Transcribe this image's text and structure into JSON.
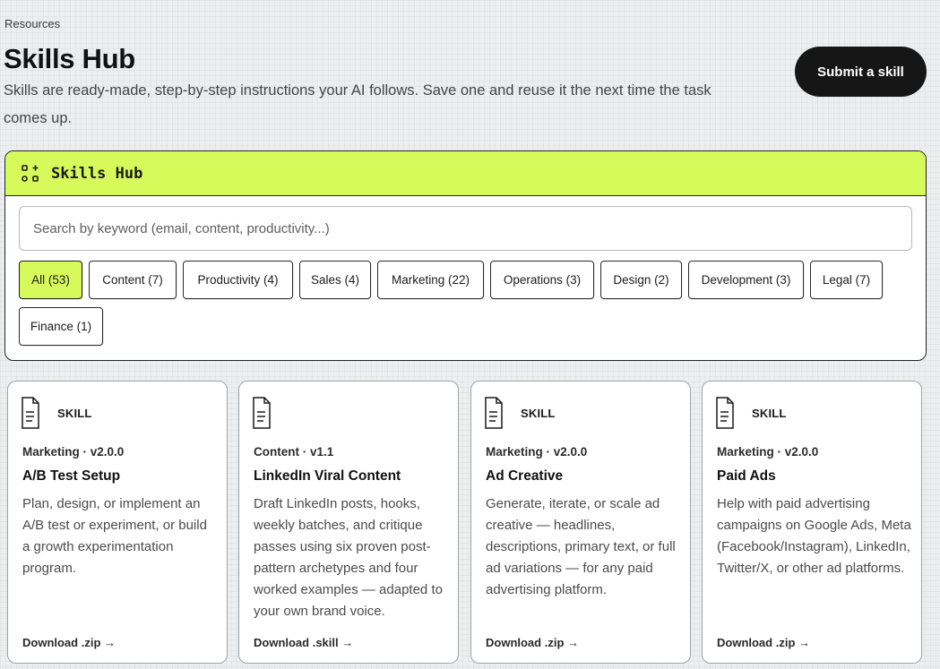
{
  "breadcrumb": "Resources",
  "header": {
    "title": "Skills Hub",
    "description": "Skills are ready-made, step-by-step instructions your AI follows. Save one and reuse it the next time the task comes up.",
    "submit_label": "Submit a skill"
  },
  "hub": {
    "icon": "grid-plus-icon",
    "title": "Skills Hub",
    "search_placeholder": "Search by keyword (email, content, productivity...)",
    "search_value": "",
    "filters": [
      {
        "label": "All (53)",
        "active": true
      },
      {
        "label": "Content (7)",
        "active": false
      },
      {
        "label": "Productivity (4)",
        "active": false
      },
      {
        "label": "Sales (4)",
        "active": false
      },
      {
        "label": "Marketing (22)",
        "active": false
      },
      {
        "label": "Operations (3)",
        "active": false
      },
      {
        "label": "Design (2)",
        "active": false
      },
      {
        "label": "Development (3)",
        "active": false
      },
      {
        "label": "Legal (7)",
        "active": false
      },
      {
        "label": "Finance (1)",
        "active": false
      }
    ]
  },
  "cards": [
    {
      "icon": "document-icon",
      "tag": "SKILL",
      "meta": "Marketing · v2.0.0",
      "title": "A/B Test Setup",
      "description": "Plan, design, or implement an A/B test or experiment, or build a growth experimentation program.",
      "download": "Download .zip →"
    },
    {
      "icon": "document-icon",
      "tag": "",
      "meta": "Content · v1.1",
      "title": "LinkedIn Viral Content",
      "description": "Draft LinkedIn posts, hooks, weekly batches, and critique passes using six proven post-pattern archetypes and four worked examples — adapted to your own brand voice.",
      "download": "Download .skill →"
    },
    {
      "icon": "document-icon",
      "tag": "SKILL",
      "meta": "Marketing · v2.0.0",
      "title": "Ad Creative",
      "description": "Generate, iterate, or scale ad creative — headlines, descriptions, primary text, or full ad variations — for any paid advertising platform.",
      "download": "Download .zip →"
    },
    {
      "icon": "document-icon",
      "tag": "SKILL",
      "meta": "Marketing · v2.0.0",
      "title": "Paid Ads",
      "description": "Help with paid advertising campaigns on Google Ads, Meta (Facebook/Instagram), LinkedIn, Twitter/X, or other ad platforms.",
      "download": "Download .zip →"
    }
  ],
  "colors": {
    "accent": "#d6fa5a",
    "dark": "#161616",
    "background": "#eceef0"
  }
}
